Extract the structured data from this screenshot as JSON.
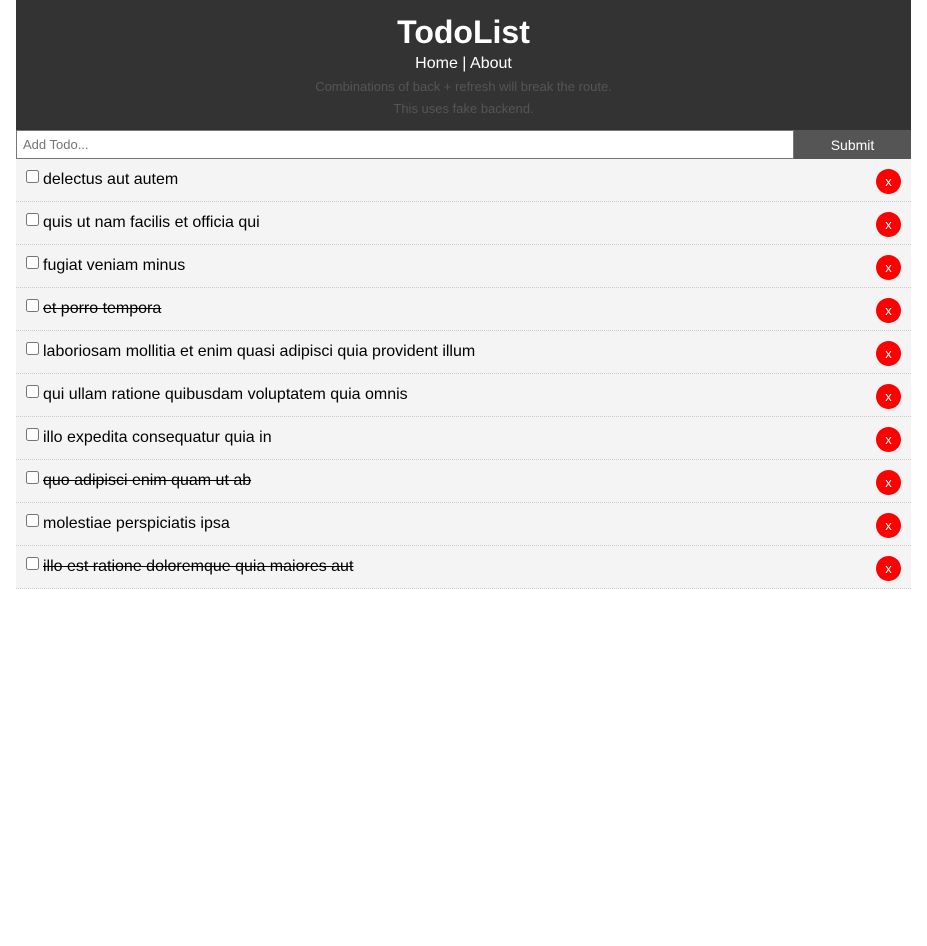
{
  "header": {
    "title": "TodoList",
    "nav": {
      "home_label": "Home",
      "separator": " | ",
      "about_label": "About"
    },
    "notes": [
      "Combinations of back + refresh will break the route.",
      "This uses fake backend."
    ]
  },
  "form": {
    "placeholder": "Add Todo...",
    "value": "",
    "submit_label": "Submit"
  },
  "todos": [
    {
      "title": "delectus aut autem",
      "completed": false
    },
    {
      "title": "quis ut nam facilis et officia qui",
      "completed": false
    },
    {
      "title": "fugiat veniam minus",
      "completed": false
    },
    {
      "title": "et porro tempora",
      "completed": true
    },
    {
      "title": "laboriosam mollitia et enim quasi adipisci quia provident illum",
      "completed": false
    },
    {
      "title": "qui ullam ratione quibusdam voluptatem quia omnis",
      "completed": false
    },
    {
      "title": "illo expedita consequatur quia in",
      "completed": false
    },
    {
      "title": "quo adipisci enim quam ut ab",
      "completed": true
    },
    {
      "title": "molestiae perspiciatis ipsa",
      "completed": false
    },
    {
      "title": "illo est ratione doloremque quia maiores aut",
      "completed": true
    }
  ],
  "delete_label": "x",
  "colors": {
    "header_bg": "#333333",
    "item_bg": "#f4f4f4",
    "delete_bg": "#ff0000",
    "submit_bg": "#555555"
  }
}
